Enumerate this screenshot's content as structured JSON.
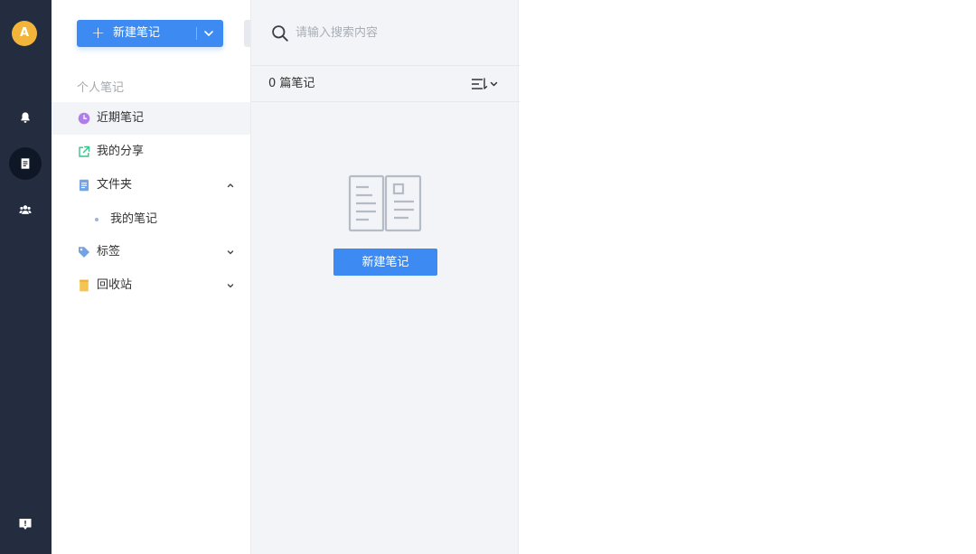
{
  "rail": {
    "avatar_initial": "A",
    "icons": [
      "bell-icon",
      "note-icon",
      "team-icon",
      "feedback-icon"
    ],
    "active": "note-icon"
  },
  "sidebar": {
    "new_note_label": "新建笔记",
    "section_title": "个人笔记",
    "items": [
      {
        "label": "近期笔记",
        "icon": "clock-icon",
        "active": true
      },
      {
        "label": "我的分享",
        "icon": "share-icon"
      },
      {
        "label": "文件夹",
        "icon": "folder-icon",
        "expanded": true,
        "children": [
          {
            "label": "我的笔记"
          }
        ]
      },
      {
        "label": "标签",
        "icon": "tag-icon",
        "expanded": false
      },
      {
        "label": "回收站",
        "icon": "trash-icon",
        "expanded": false
      }
    ]
  },
  "note_list": {
    "search_placeholder": "请输入搜索内容",
    "count_label": "0 篇笔记",
    "empty_button_label": "新建笔记"
  },
  "colors": {
    "rail_bg": "#232d3f",
    "accent": "#3d8bf2",
    "avatar": "#f2b53a",
    "list_bg": "#f2f4f7"
  }
}
